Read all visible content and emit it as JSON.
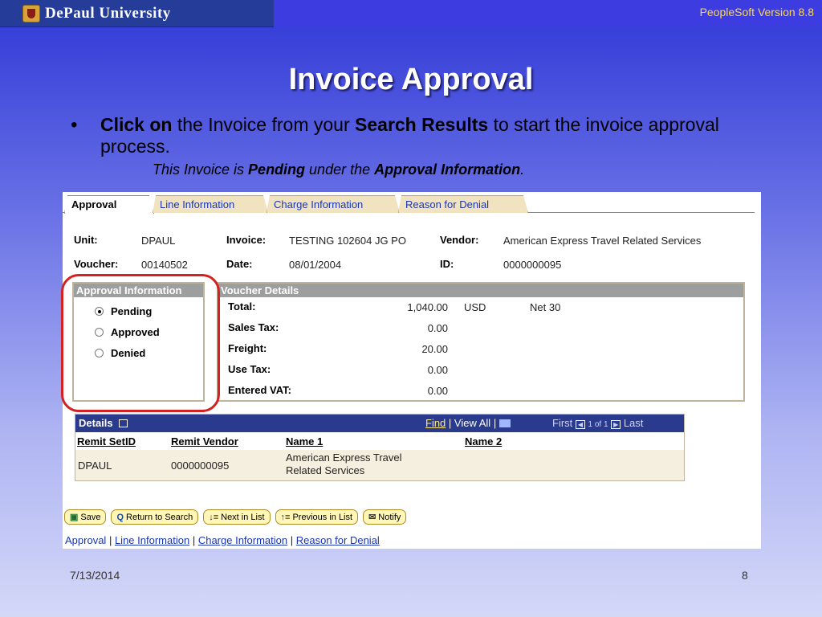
{
  "header": {
    "university": "DePaul University",
    "version": "PeopleSoft Version 8.8"
  },
  "slide": {
    "title": "Invoice Approval",
    "bullet_symbol": "•",
    "bullet_bold1": "Click on",
    "bullet_text1": " the Invoice from your ",
    "bullet_bold2": "Search Results",
    "bullet_text2": " to start the invoice approval process.",
    "note_text1": "This Invoice is ",
    "note_bold1": "Pending",
    "note_text2": " under the ",
    "note_bold2": "Approval Information",
    "note_text3": "."
  },
  "tabs": [
    {
      "label": "Approval",
      "active": true
    },
    {
      "label": "Line Information",
      "active": false
    },
    {
      "label": "Charge Information",
      "active": false
    },
    {
      "label": "Reason for Denial",
      "active": false
    }
  ],
  "header_fields": {
    "unit_label": "Unit:",
    "unit_value": "DPAUL",
    "invoice_label": "Invoice:",
    "invoice_value": "TESTING 102604 JG PO",
    "vendor_label": "Vendor:",
    "vendor_value": "American Express Travel Related Services",
    "voucher_label": "Voucher:",
    "voucher_value": "00140502",
    "date_label": "Date:",
    "date_value": "08/01/2004",
    "id_label": "ID:",
    "id_value": "0000000095"
  },
  "approval_info": {
    "title": "Approval Information",
    "options": [
      {
        "label": "Pending",
        "selected": true
      },
      {
        "label": "Approved",
        "selected": false
      },
      {
        "label": "Denied",
        "selected": false
      }
    ]
  },
  "voucher_details": {
    "title": "Voucher Details",
    "rows": [
      {
        "label": "Total:",
        "amount": "1,040.00",
        "currency": "USD",
        "terms": "Net 30"
      },
      {
        "label": "Sales Tax:",
        "amount": "0.00",
        "currency": "",
        "terms": ""
      },
      {
        "label": "Freight:",
        "amount": "20.00",
        "currency": "",
        "terms": ""
      },
      {
        "label": "Use Tax:",
        "amount": "0.00",
        "currency": "",
        "terms": ""
      },
      {
        "label": "Entered VAT:",
        "amount": "0.00",
        "currency": "",
        "terms": ""
      }
    ]
  },
  "details": {
    "title": "Details",
    "find_link": "Find",
    "view_all": "View All",
    "first": "First",
    "range": "1 of 1",
    "last": "Last",
    "columns": [
      "Remit SetID",
      "Remit Vendor",
      "Name 1",
      "Name 2"
    ],
    "row": {
      "setid": "DPAUL",
      "vendor": "0000000095",
      "name1_line1": "American Express Travel",
      "name1_line2": "Related Services",
      "name2": ""
    }
  },
  "buttons": [
    {
      "label": "Save",
      "icon": "save-icon"
    },
    {
      "label": "Return to Search",
      "icon": "search-icon"
    },
    {
      "label": "Next in List",
      "icon": "next-list-icon"
    },
    {
      "label": "Previous in List",
      "icon": "previous-list-icon"
    },
    {
      "label": "Notify",
      "icon": "notify-icon"
    }
  ],
  "bottom_links": [
    "Approval",
    "Line Information",
    "Charge Information",
    "Reason for Denial"
  ],
  "footer": {
    "date": "7/13/2014",
    "page": "8"
  }
}
